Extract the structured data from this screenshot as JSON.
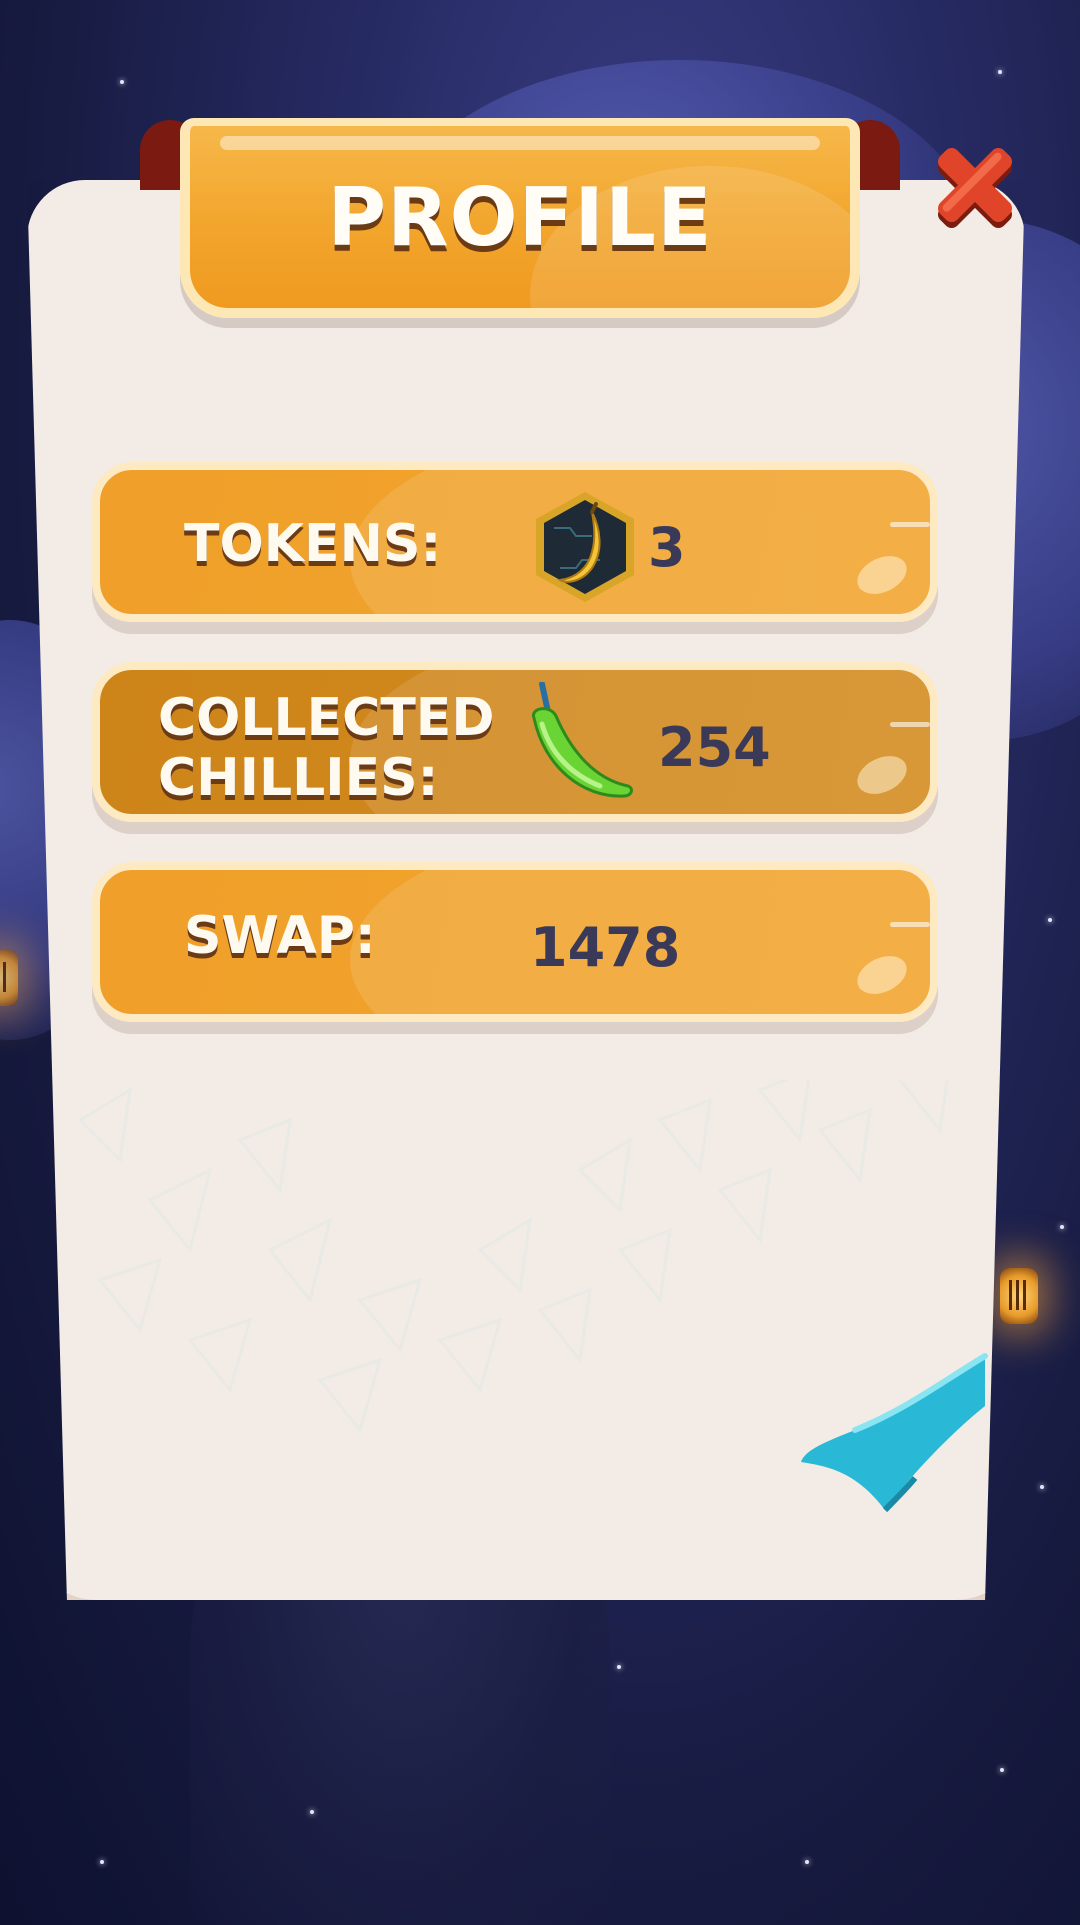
{
  "title": "PROFILE",
  "close_button": {
    "icon": "close-icon",
    "color": "#e0452a"
  },
  "rows": [
    {
      "label": "TOKENS:",
      "icon": "banana-token-icon",
      "value": "3"
    },
    {
      "label": "COLLECTED\nCHILLIES:",
      "icon": "green-chilli-icon",
      "value": "254"
    },
    {
      "label": "SWAP:",
      "value": "1478"
    }
  ],
  "colors": {
    "panel": "#f3ece6",
    "row_orange": "#f2a42d",
    "row_dark": "#d38a1c",
    "value_text": "#3a3a58",
    "background": "#262a62"
  }
}
